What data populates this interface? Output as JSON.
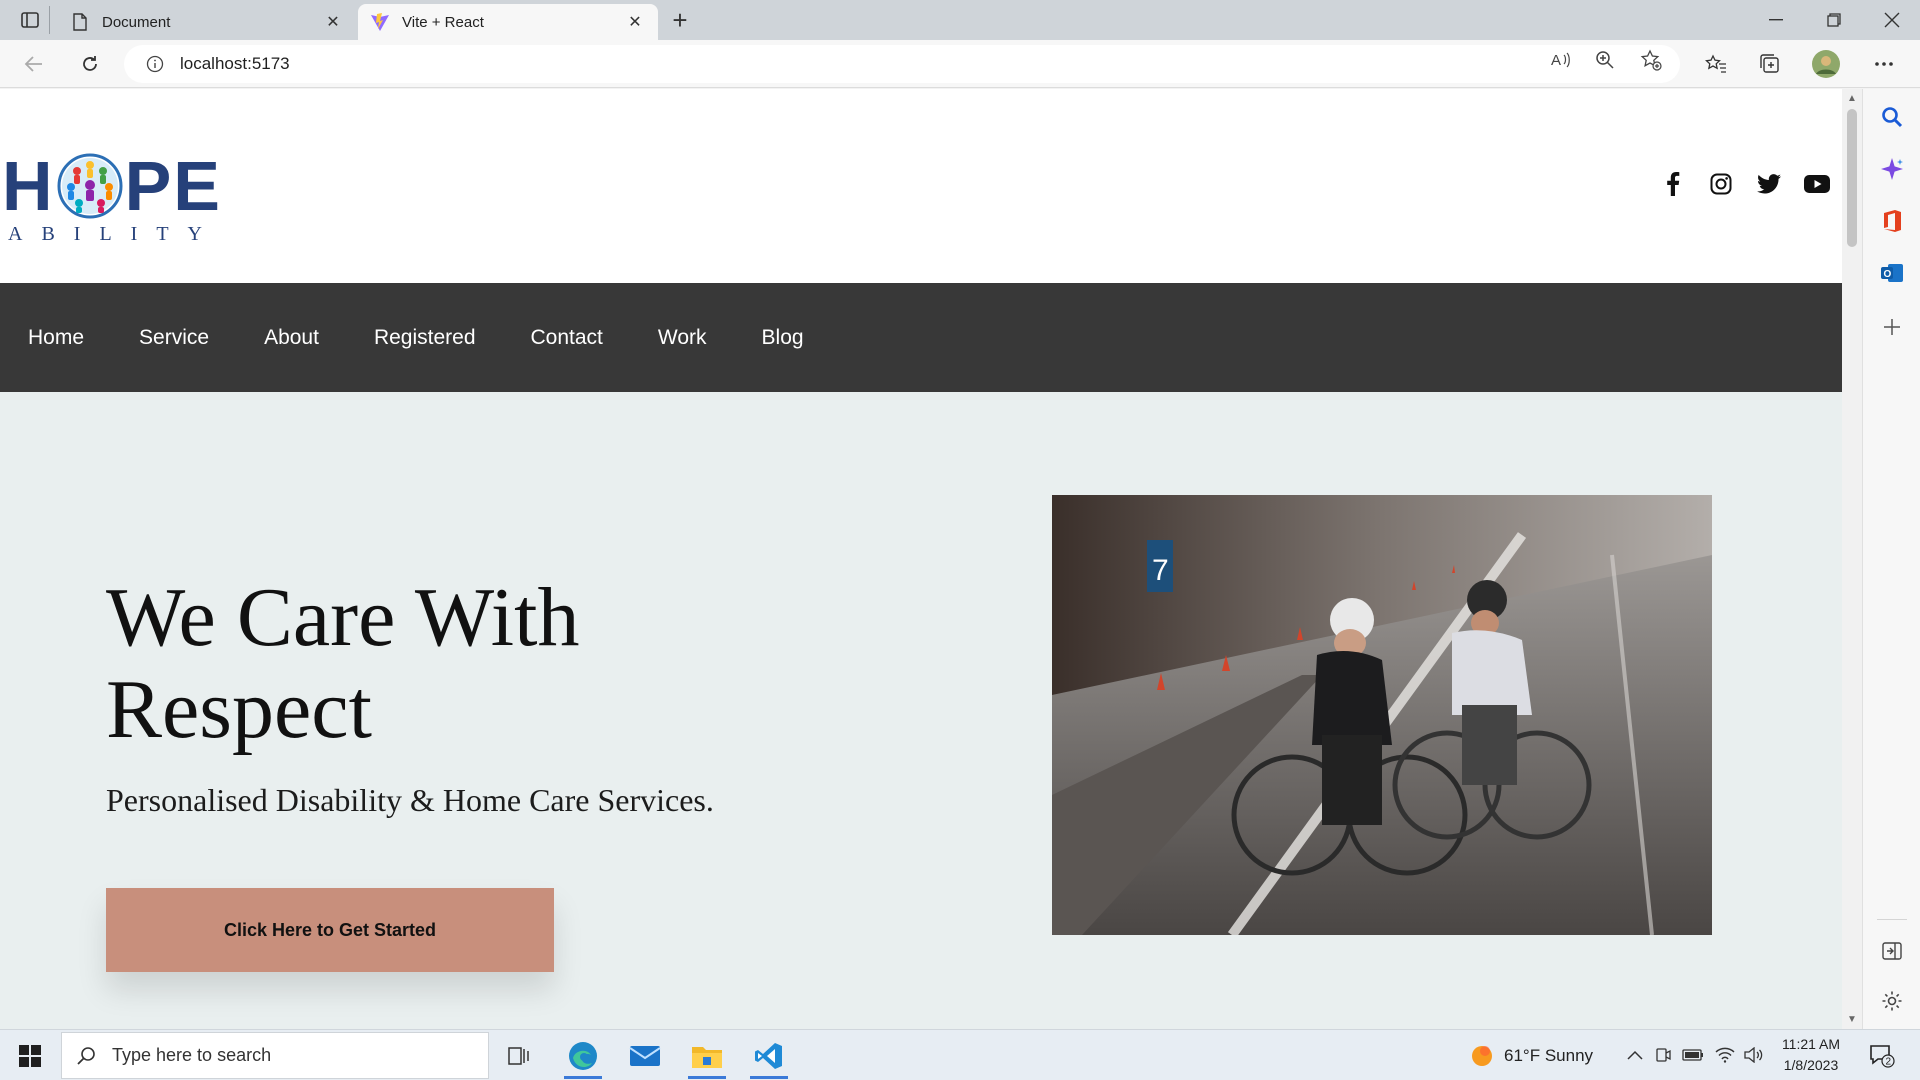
{
  "browser": {
    "tabs": [
      {
        "title": "Document",
        "active": false
      },
      {
        "title": "Vite + React",
        "active": true
      }
    ],
    "url": "localhost:5173"
  },
  "site": {
    "logo": {
      "top": "H",
      "top_rest": "PE",
      "bottom": "ABILITY"
    },
    "social_icons": [
      "facebook-icon",
      "instagram-icon",
      "twitter-icon",
      "youtube-icon"
    ],
    "nav": [
      "Home",
      "Service",
      "About",
      "Registered",
      "Contact",
      "Work",
      "Blog"
    ],
    "hero": {
      "title_line1": "We Care With",
      "title_line2": "Respect",
      "subtitle": "Personalised Disability & Home Care Services.",
      "cta_label": "Click Here to Get Started"
    },
    "colors": {
      "nav_bg": "#383838",
      "hero_bg": "#e9efef",
      "cta_bg": "#c88f7c",
      "logo_blue": "#26417a"
    }
  },
  "taskbar": {
    "search_placeholder": "Type here to search",
    "weather": "61°F  Sunny",
    "time": "11:21 AM",
    "date": "1/8/2023",
    "notification_count": "2"
  }
}
